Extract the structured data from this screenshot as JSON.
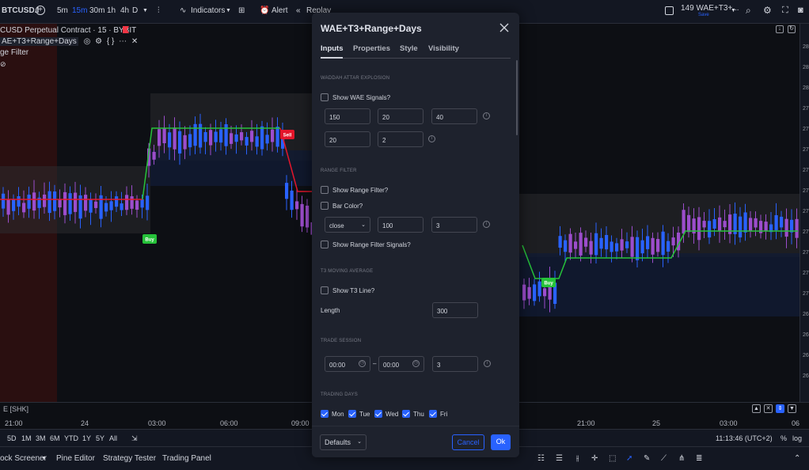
{
  "toolbar": {
    "symbol": "BTCUSD.I",
    "timeframes": [
      "5m",
      "15m",
      "30m",
      "1h",
      "4h",
      "D"
    ],
    "active_timeframe": "15m",
    "indicators_label": "Indicators",
    "alert_label": "Alert",
    "replay_label": "Replay",
    "layout_name": "149 WAE+T3+...",
    "layout_status": "Save"
  },
  "legend": {
    "title": "CUSD Perpetual Contract · 15 · BYBIT",
    "indicator": "AE+T3+Range+Days",
    "filter": "ge Filter"
  },
  "chart": {
    "buy_label": "Buy",
    "sell_label": "Sell",
    "buy_color": "#26c23a",
    "sell_color": "#e3162b",
    "up_color": "#2962ff",
    "down_color": "#9c4dcc"
  },
  "price_axis": [
    "28",
    "28",
    "28",
    "27",
    "27",
    "27",
    "27",
    "27",
    "27",
    "27",
    "27",
    "27",
    "27",
    "26",
    "26",
    "26",
    "26"
  ],
  "time_axis": {
    "tz_label": "E [SHK]",
    "ticks": [
      "21:00",
      "24",
      "03:00",
      "06:00",
      "09:00",
      "21:00",
      "25",
      "03:00",
      "06"
    ]
  },
  "range_bar": {
    "ranges": [
      "5D",
      "1M",
      "3M",
      "6M",
      "YTD",
      "1Y",
      "5Y",
      "All"
    ],
    "clock": "11:13:46 (UTC+2)",
    "percent": "%",
    "log": "log"
  },
  "bottom_bar": {
    "tabs": [
      "ock Screener",
      "Pine Editor",
      "Strategy Tester",
      "Trading Panel"
    ]
  },
  "dialog": {
    "title": "WAE+T3+Range+Days",
    "tabs": [
      "Inputs",
      "Properties",
      "Style",
      "Visibility"
    ],
    "sections": {
      "wae": "WADDAH ATTAR EXPLOSION",
      "range": "RANGE FILTER",
      "t3": "T3 MOVING AVERAGE",
      "session": "TRADE SESSION",
      "days": "TRADING DAYS"
    },
    "show_wae": "Show WAE Signals?",
    "wae_inputs_row1": [
      "150",
      "20",
      "40"
    ],
    "wae_inputs_row2": [
      "20",
      "2"
    ],
    "show_range": "Show Range Filter?",
    "bar_color": "Bar Color?",
    "range_source": "close",
    "range_period": "100",
    "range_mult": "3",
    "show_range_signals": "Show Range Filter Signals?",
    "show_t3": "Show T3 Line?",
    "length_label": "Length",
    "length_value": "300",
    "session_start": "00:00",
    "session_dash": "–",
    "session_end": "00:00",
    "session_count": "3",
    "days": [
      "Mon",
      "Tue",
      "Wed",
      "Thu",
      "Fri"
    ],
    "defaults_label": "Defaults",
    "cancel_label": "Cancel",
    "ok_label": "Ok"
  }
}
